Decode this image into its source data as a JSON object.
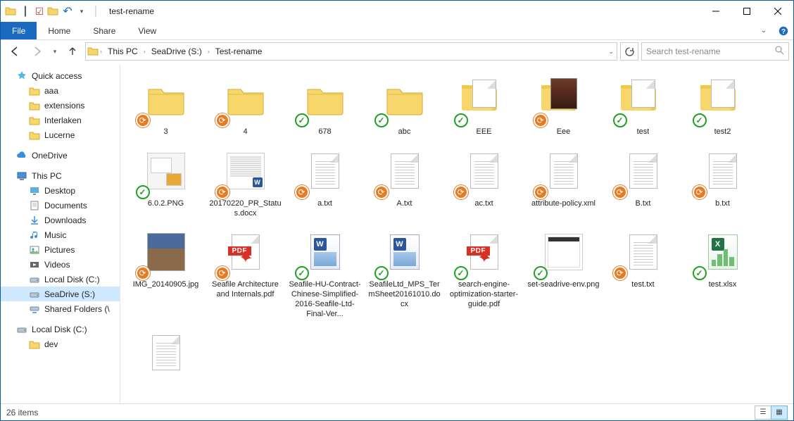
{
  "window_title": "test-rename",
  "ribbon": {
    "file": "File",
    "tabs": [
      "Home",
      "Share",
      "View"
    ]
  },
  "breadcrumbs": [
    "This PC",
    "SeaDrive (S:)",
    "Test-rename"
  ],
  "search_placeholder": "Search test-rename",
  "status": {
    "count": "26 items"
  },
  "sidebar": [
    {
      "label": "Quick access",
      "icon": "star",
      "color": "#3399dd",
      "lvl": 1
    },
    {
      "label": "aaa",
      "icon": "folder",
      "lvl": 2
    },
    {
      "label": "extensions",
      "icon": "folder",
      "lvl": 2
    },
    {
      "label": "Interlaken",
      "icon": "folder",
      "lvl": 2
    },
    {
      "label": "Lucerne",
      "icon": "folder",
      "lvl": 2
    },
    {
      "sep": true
    },
    {
      "label": "OneDrive",
      "icon": "cloud",
      "color": "#0a67c4",
      "lvl": 1
    },
    {
      "sep": true
    },
    {
      "label": "This PC",
      "icon": "pc",
      "lvl": 1
    },
    {
      "label": "Desktop",
      "icon": "desktop",
      "lvl": 2
    },
    {
      "label": "Documents",
      "icon": "doc",
      "lvl": 2
    },
    {
      "label": "Downloads",
      "icon": "down",
      "lvl": 2
    },
    {
      "label": "Music",
      "icon": "music",
      "lvl": 2
    },
    {
      "label": "Pictures",
      "icon": "pic",
      "lvl": 2
    },
    {
      "label": "Videos",
      "icon": "video",
      "lvl": 2
    },
    {
      "label": "Local Disk (C:)",
      "icon": "drive",
      "lvl": 2
    },
    {
      "label": "SeaDrive (S:)",
      "icon": "drive",
      "lvl": 2,
      "selected": true
    },
    {
      "label": "Shared Folders (\\",
      "icon": "netdrive",
      "lvl": 2
    },
    {
      "sep": true
    },
    {
      "label": "Local Disk (C:)",
      "icon": "drive",
      "lvl": 1
    },
    {
      "label": "dev",
      "icon": "folder",
      "lvl": 2
    }
  ],
  "items": [
    {
      "name": "3",
      "kind": "folder",
      "badge": "orange"
    },
    {
      "name": "4",
      "kind": "folder",
      "badge": "orange"
    },
    {
      "name": "678",
      "kind": "folder",
      "badge": "green"
    },
    {
      "name": "abc",
      "kind": "folder",
      "badge": "green"
    },
    {
      "name": "EEE",
      "kind": "folder-open",
      "badge": "green"
    },
    {
      "name": "Eee",
      "kind": "folder-open-img",
      "badge": "orange"
    },
    {
      "name": "test",
      "kind": "folder-open",
      "badge": "green"
    },
    {
      "name": "test2",
      "kind": "folder-open",
      "badge": "green"
    },
    {
      "name": "6.0.2.PNG",
      "kind": "png",
      "badge": "green"
    },
    {
      "name": "20170220_PR_Status.docx",
      "kind": "word-thumb",
      "badge": "orange"
    },
    {
      "name": "a.txt",
      "kind": "txt",
      "badge": "orange"
    },
    {
      "name": "A.txt",
      "kind": "txt",
      "badge": "orange"
    },
    {
      "name": "ac.txt",
      "kind": "txt",
      "badge": "orange"
    },
    {
      "name": "attribute-policy.xml",
      "kind": "txt",
      "badge": "orange"
    },
    {
      "name": "B.txt",
      "kind": "txt",
      "badge": "orange"
    },
    {
      "name": "b.txt",
      "kind": "txt",
      "badge": "orange"
    },
    {
      "name": "IMG_20140905.jpg",
      "kind": "image",
      "badge": "orange"
    },
    {
      "name": "Seafile Architecture and Internals.pdf",
      "kind": "pdf",
      "badge": "orange"
    },
    {
      "name": "Seafile-HU-Contract-Chinese-Simplified-2016-Seafile-Ltd-Final-Ver...",
      "kind": "word",
      "badge": "green"
    },
    {
      "name": "SeafileLtd_MPS_TermSheet20161010.docx",
      "kind": "word",
      "badge": "green"
    },
    {
      "name": "search-engine-optimization-starter-guide.pdf",
      "kind": "pdf",
      "badge": "green"
    },
    {
      "name": "set-seadrive-env.png",
      "kind": "png2",
      "badge": "green"
    },
    {
      "name": "test.txt",
      "kind": "txt",
      "badge": "orange"
    },
    {
      "name": "test.xlsx",
      "kind": "excel",
      "badge": "green"
    },
    {
      "name": "",
      "kind": "txt",
      "badge": ""
    }
  ]
}
